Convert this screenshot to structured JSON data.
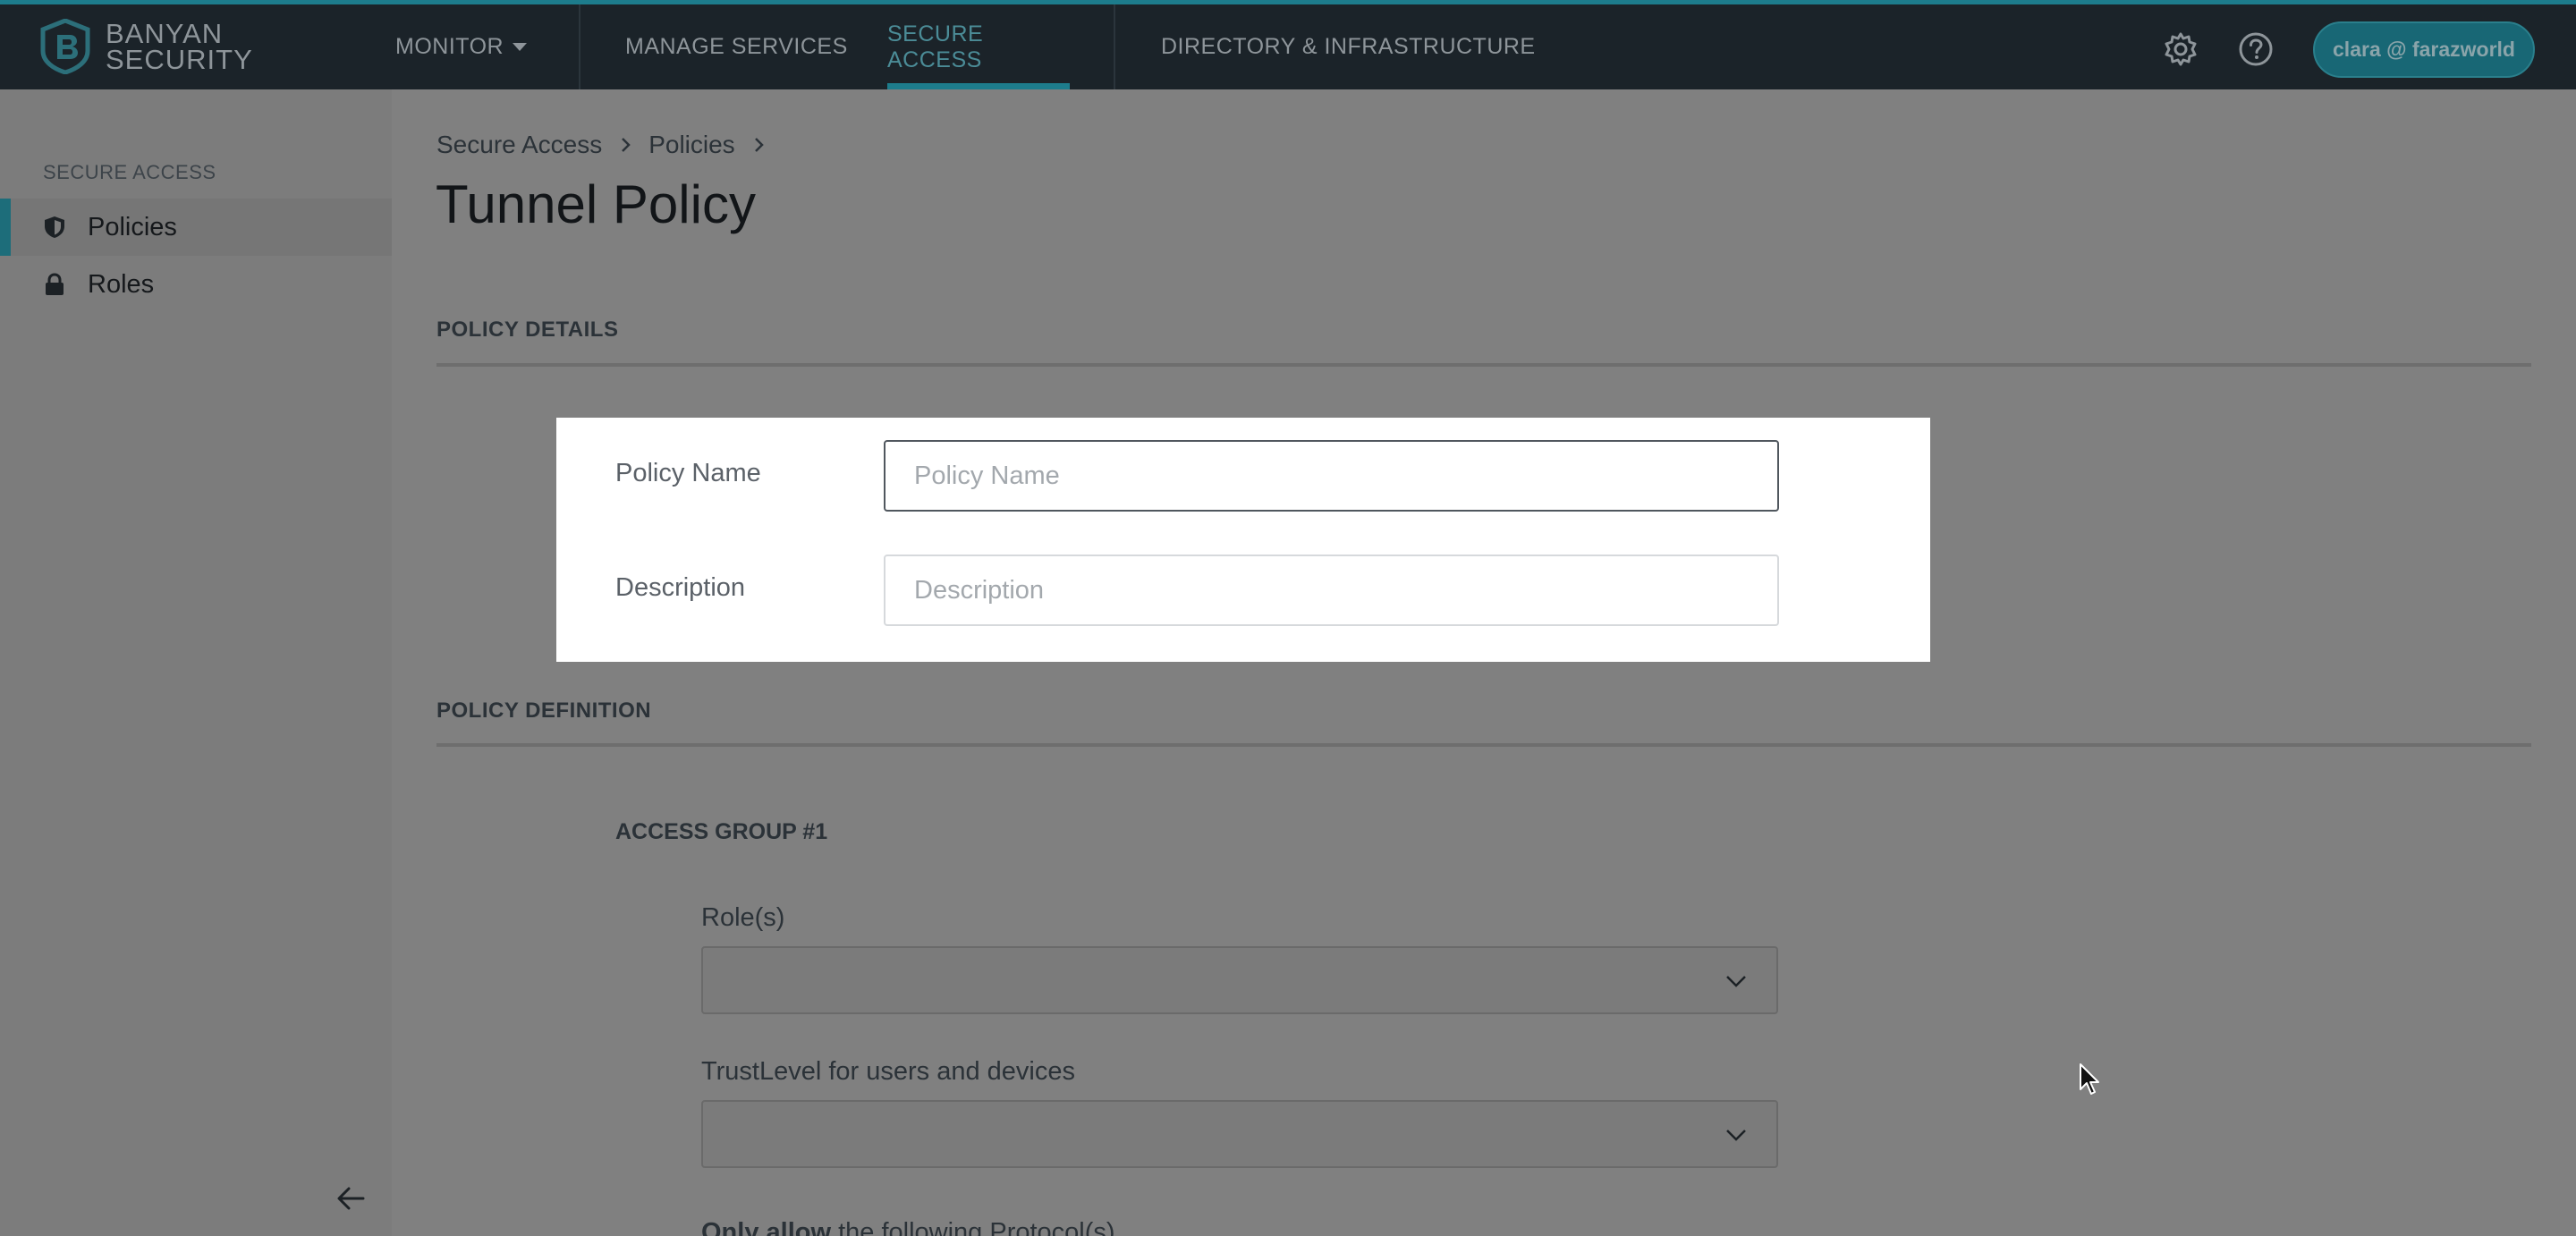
{
  "brand": {
    "line1": "BANYAN",
    "line2": "SECURITY"
  },
  "nav": {
    "monitor": "MONITOR",
    "manage_services": "MANAGE SERVICES",
    "secure_access": "SECURE ACCESS",
    "directory": "DIRECTORY & INFRASTRUCTURE",
    "user": "clara @ farazworld",
    "icons": [
      "gear-icon",
      "help-icon"
    ]
  },
  "sidebar": {
    "heading": "SECURE ACCESS",
    "items": [
      {
        "label": "Policies",
        "icon": "shield-icon",
        "active": true
      },
      {
        "label": "Roles",
        "icon": "lock-icon",
        "active": false
      }
    ]
  },
  "breadcrumb": [
    "Secure Access",
    "Policies"
  ],
  "page": {
    "title": "Tunnel Policy"
  },
  "policy_details": {
    "section": "POLICY DETAILS",
    "name_label": "Policy Name",
    "name_placeholder": "Policy Name",
    "name_value": "",
    "description_label": "Description",
    "description_placeholder": "Description",
    "description_value": ""
  },
  "policy_definition": {
    "section": "POLICY DEFINITION",
    "group_title": "ACCESS GROUP #1",
    "roles_label": "Role(s)",
    "trustlevel_label": "TrustLevel for users and devices",
    "cut_text_bold": "Only allow",
    "cut_text_rest": " the following Protocol(s)"
  },
  "colors": {
    "accent": "#1d7c8c",
    "topbar": "#1b2329",
    "overlay": "#808080"
  }
}
